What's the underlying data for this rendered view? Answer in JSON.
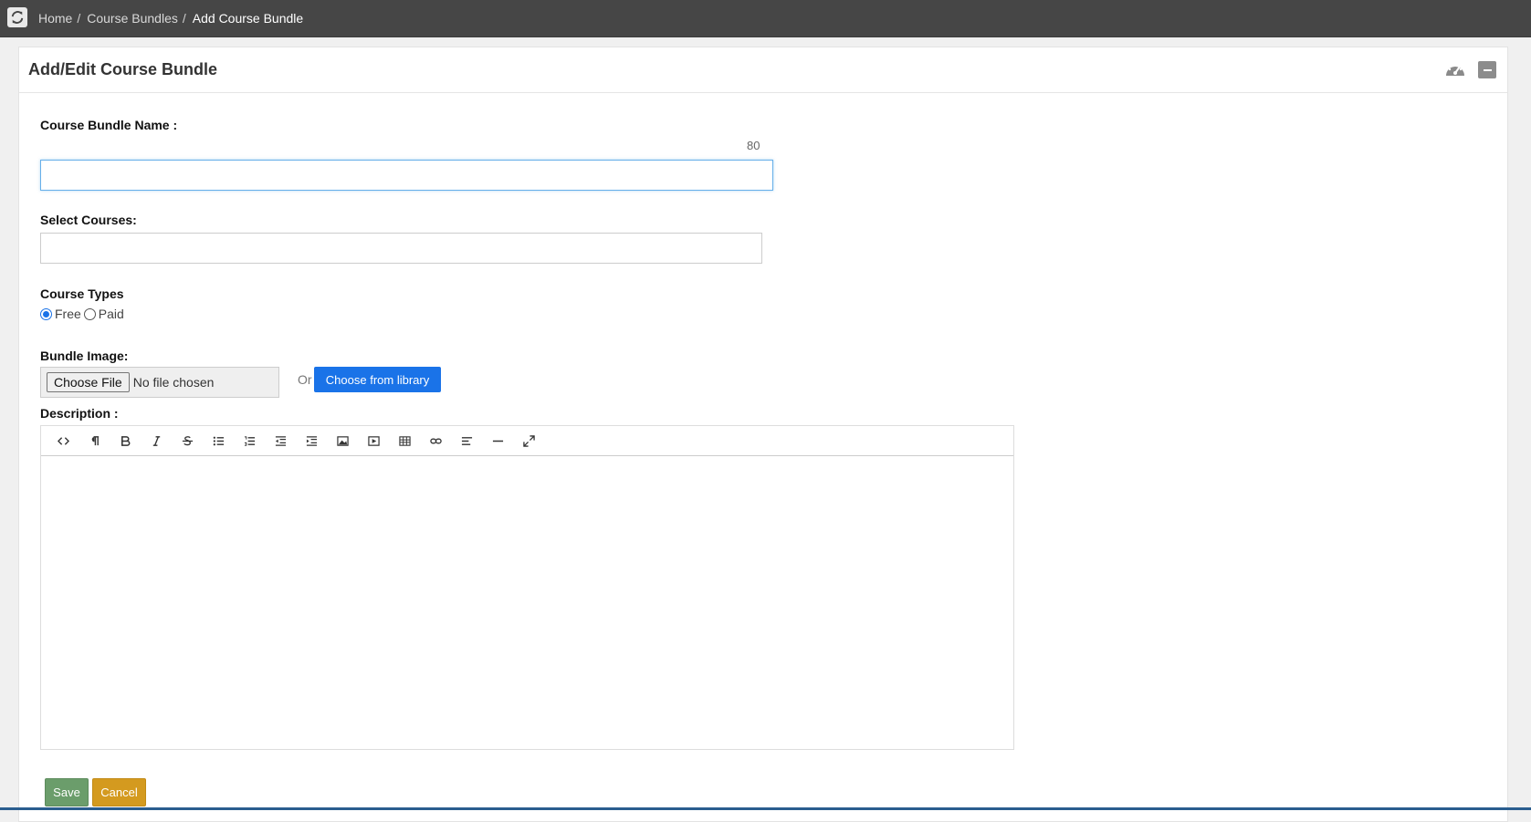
{
  "breadcrumb": {
    "items": [
      "Home",
      "Course Bundles"
    ],
    "current": "Add Course Bundle",
    "separator": "/"
  },
  "panel": {
    "title": "Add/Edit Course Bundle"
  },
  "form": {
    "bundle_name_label": "Course Bundle Name :",
    "bundle_name_counter": "80",
    "bundle_name_value": "",
    "select_courses_label": "Select Courses:",
    "course_types_label": "Course Types",
    "course_types": [
      {
        "label": "Free",
        "selected": true
      },
      {
        "label": "Paid",
        "selected": false
      }
    ],
    "bundle_image_label": "Bundle Image:",
    "choose_file_label": "Choose File",
    "no_file_text": "No file chosen",
    "or_text": "Or",
    "choose_library_label": "Choose from library",
    "description_label": "Description :",
    "save_label": "Save",
    "cancel_label": "Cancel"
  },
  "editor_toolbar": [
    "code-view-icon",
    "paragraph-icon",
    "bold-icon",
    "italic-icon",
    "strikethrough-icon",
    "unordered-list-icon",
    "ordered-list-icon",
    "outdent-icon",
    "indent-icon",
    "image-icon",
    "video-icon",
    "table-icon",
    "link-icon",
    "align-icon",
    "horizontal-rule-icon",
    "fullscreen-icon"
  ],
  "colors": {
    "topbar": "#464646",
    "primary": "#1a73e8",
    "save": "#6b9d6b",
    "cancel": "#d49a1f"
  }
}
